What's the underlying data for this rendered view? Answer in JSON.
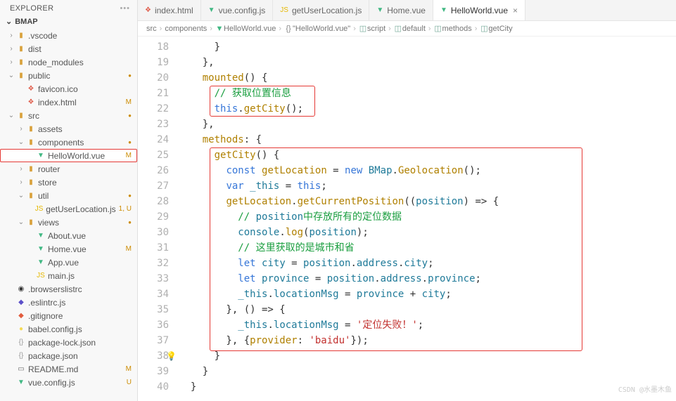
{
  "sidebar": {
    "title": "EXPLORER",
    "root": "BMAP",
    "tree": [
      {
        "d": 0,
        "t": "folder",
        "o": 0,
        "n": ".vscode"
      },
      {
        "d": 0,
        "t": "folder",
        "o": 0,
        "n": "dist"
      },
      {
        "d": 0,
        "t": "folder",
        "o": 0,
        "n": "node_modules"
      },
      {
        "d": 0,
        "t": "folder",
        "o": 1,
        "n": "public",
        "dot": true
      },
      {
        "d": 1,
        "t": "file",
        "ic": "html",
        "n": "favicon.ico"
      },
      {
        "d": 1,
        "t": "file",
        "ic": "html",
        "n": "index.html",
        "b": "M"
      },
      {
        "d": 0,
        "t": "folder",
        "o": 1,
        "n": "src",
        "dot": true
      },
      {
        "d": 1,
        "t": "folder",
        "o": 0,
        "n": "assets"
      },
      {
        "d": 1,
        "t": "folder",
        "o": 1,
        "n": "components",
        "dot": true
      },
      {
        "d": 2,
        "t": "file",
        "ic": "vue",
        "n": "HelloWorld.vue",
        "b": "M",
        "sel": true
      },
      {
        "d": 1,
        "t": "folder",
        "o": 0,
        "n": "router"
      },
      {
        "d": 1,
        "t": "folder",
        "o": 0,
        "n": "store"
      },
      {
        "d": 1,
        "t": "folder",
        "o": 1,
        "n": "util",
        "dot": true
      },
      {
        "d": 2,
        "t": "file",
        "ic": "js",
        "n": "getUserLocation.js",
        "b": "1, U"
      },
      {
        "d": 1,
        "t": "folder",
        "o": 1,
        "n": "views",
        "dot": true
      },
      {
        "d": 2,
        "t": "file",
        "ic": "vue",
        "n": "About.vue"
      },
      {
        "d": 2,
        "t": "file",
        "ic": "vue",
        "n": "Home.vue",
        "b": "M"
      },
      {
        "d": 2,
        "t": "file",
        "ic": "vue",
        "n": "App.vue"
      },
      {
        "d": 2,
        "t": "file",
        "ic": "js",
        "n": "main.js"
      },
      {
        "d": 0,
        "t": "file",
        "ic": "browsers",
        "n": ".browserslistrc"
      },
      {
        "d": 0,
        "t": "file",
        "ic": "eslint",
        "n": ".eslintrc.js"
      },
      {
        "d": 0,
        "t": "file",
        "ic": "git",
        "n": ".gitignore"
      },
      {
        "d": 0,
        "t": "file",
        "ic": "babel",
        "n": "babel.config.js"
      },
      {
        "d": 0,
        "t": "file",
        "ic": "json",
        "n": "package-lock.json"
      },
      {
        "d": 0,
        "t": "file",
        "ic": "json",
        "n": "package.json"
      },
      {
        "d": 0,
        "t": "file",
        "ic": "md",
        "n": "README.md",
        "b": "M"
      },
      {
        "d": 0,
        "t": "file",
        "ic": "vue",
        "n": "vue.config.js",
        "b": "U"
      }
    ]
  },
  "tabs": [
    {
      "ic": "html",
      "label": "index.html"
    },
    {
      "ic": "vue",
      "label": "vue.config.js"
    },
    {
      "ic": "js",
      "label": "getUserLocation.js"
    },
    {
      "ic": "vue",
      "label": "Home.vue"
    },
    {
      "ic": "vue",
      "label": "HelloWorld.vue",
      "active": true,
      "close": true
    }
  ],
  "breadcrumbs": [
    {
      "label": "src"
    },
    {
      "label": "components"
    },
    {
      "ic": "vue",
      "label": "HelloWorld.vue"
    },
    {
      "ic": "braces",
      "label": "\"HelloWorld.vue\""
    },
    {
      "ic": "cube",
      "label": "script"
    },
    {
      "ic": "cube",
      "label": "default"
    },
    {
      "ic": "cube",
      "label": "methods"
    },
    {
      "ic": "cube",
      "label": "getCity"
    }
  ],
  "editor": {
    "startLine": 18,
    "lines": [
      "      }",
      "    },",
      "    mounted() {",
      "      // 获取位置信息",
      "      this.getCity();",
      "    },",
      "    methods: {",
      "      getCity() {",
      "        const getLocation = new BMap.Geolocation();",
      "        var _this = this;",
      "        getLocation.getCurrentPosition((position) => {",
      "          // position中存放所有的定位数据",
      "          console.log(position);",
      "          // 这里获取的是城市和省",
      "          let city = position.address.city;",
      "          let province = position.address.province;",
      "          _this.locationMsg = province + city;",
      "        }, () => {",
      "          _this.locationMsg = '定位失败！';",
      "        }, {provider: 'baidu'});",
      "      }",
      "    }",
      "  }"
    ]
  },
  "watermark": "CSDN @水墨木鱼"
}
